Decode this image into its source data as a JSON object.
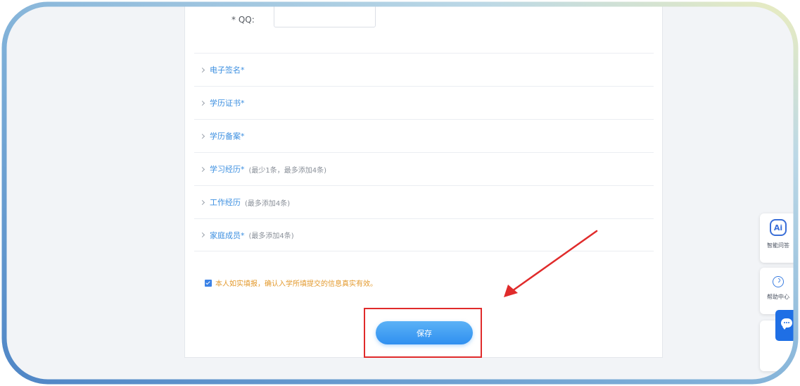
{
  "form": {
    "qq_label": "* QQ:",
    "qq_value": "",
    "sections": [
      {
        "label": "电子签名*",
        "note": ""
      },
      {
        "label": "学历证书*",
        "note": ""
      },
      {
        "label": "学历备案*",
        "note": ""
      },
      {
        "label": "学习经历*",
        "note": "(最少1条，最多添加4条)"
      },
      {
        "label": "工作经历",
        "note": "(最多添加4条)"
      },
      {
        "label": "家庭成员*",
        "note": "(最多添加4条)"
      }
    ],
    "agreement_text": "本人如实填报，确认入学所填提交的信息真实有效。",
    "agreement_checked": true,
    "save_label": "保存"
  },
  "side_widget": {
    "ai_logo": "Ai",
    "ai_label": "智能问答",
    "help_label": "帮助中心"
  },
  "icons": {
    "section_toggle": "chevron-right-icon",
    "help": "help-icon",
    "chat": "chat-icon",
    "ai": "ai-logo-icon"
  },
  "colors": {
    "link_blue": "#3c8fe0",
    "agreement_orange": "#e39a2e",
    "button_blue": "#2f8ff0",
    "annotation_red": "#e02b2b",
    "chat_blue": "#1f6fe5"
  }
}
